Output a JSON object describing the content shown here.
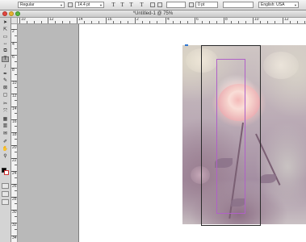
{
  "control_bar": {
    "font_style": "Regular",
    "font_size": "14.4 pt",
    "leading": "0 pt",
    "language": "English: USA",
    "t_buttons": [
      "T",
      "T",
      "T",
      "T"
    ]
  },
  "window": {
    "title": "*Untitled-1 @ 75%"
  },
  "rulers": {
    "horizontal_labels": [
      "10",
      "12",
      "14",
      "16",
      "2",
      "4",
      "6",
      "8",
      "10",
      "12"
    ],
    "vertical_labels": [
      "2",
      "4",
      "6",
      "8",
      "10",
      "12",
      "14",
      "16",
      "18",
      "20",
      "22",
      "24",
      "26",
      "28",
      "30",
      "32",
      "34"
    ]
  },
  "tools": {
    "icons": [
      "selection-icon",
      "direct-selection-icon",
      "page-icon",
      "gap-icon",
      "content-collector-icon",
      "type-icon",
      "line-icon",
      "pen-icon",
      "pencil-icon",
      "rectangle-frame-icon",
      "rectangle-icon",
      "scissors-icon",
      "free-transform-icon",
      "gradient-swatch-icon",
      "gradient-feather-icon",
      "note-icon",
      "eyedropper-icon",
      "hand-icon",
      "zoom-icon"
    ],
    "glyphs": [
      "➤",
      "⇱",
      "▭",
      "↔",
      "⧉",
      "T",
      "/",
      "✒",
      "✎",
      "⊠",
      "▢",
      "✂",
      "⤧",
      "▦",
      "▥",
      "✉",
      "✐",
      "✋",
      "⚲"
    ],
    "active_tool": "type-icon"
  },
  "colors": {
    "fill": "#000000",
    "stroke": "#ffffff",
    "frame_edge": "#2a2a2a",
    "text_frame": "#b060c8",
    "selection_handle": "#2f76d2"
  }
}
